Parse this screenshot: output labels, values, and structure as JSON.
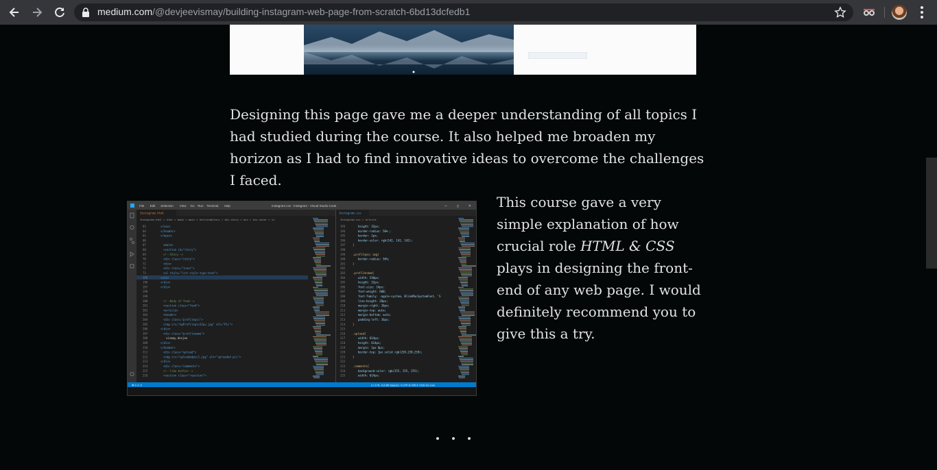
{
  "browser": {
    "url_host": "medium.com",
    "url_path": "/@devjeevismay/building-instagram-web-page-from-scratch-6bd13dcfedb1"
  },
  "article": {
    "paragraph1": "Designing this page gave me a deeper understanding of all topics I had studied during the course. It also helped me broaden my horizon as I had to find innovative ideas to overcome the challenges I faced.",
    "paragraph2_before": "This course gave a very simple explanation of how crucial role ",
    "paragraph2_em": "HTML & CSS",
    "paragraph2_after": " plays in designing the front-end of any web page. I would definitely recommend you to give this a try.",
    "separator": "· · ·"
  },
  "editor_screenshot": {
    "menu_items": [
      "File",
      "Edit",
      "Selection",
      "View",
      "Go",
      "Run",
      "Terminal",
      "Help"
    ],
    "window_title": "Instagram.css - Instagram - Visual Studio Code",
    "left_tab": "Instagram.html",
    "right_tab": "Instagram.css",
    "left_breadcrumb": "Instagram.html > html > body > main > Section#story > div.story > div > div.inner > ul",
    "right_breadcrumb": "Instagram.css > article",
    "left_lines": [
      {
        "n": "63",
        "t": "</nav>"
      },
      {
        "n": "64",
        "t": "</header>"
      },
      {
        "n": "65",
        "t": "</main>"
      },
      {
        "n": "66",
        "t": ""
      },
      {
        "n": "67",
        "t": "<main>"
      },
      {
        "n": "68",
        "t": "<section id=\"story\">"
      },
      {
        "n": "69",
        "t": "<!--Story-->"
      },
      {
        "n": "70",
        "t": "<div class=\"story\">"
      },
      {
        "n": "71",
        "t": "<div>"
      },
      {
        "n": "72",
        "t": "<div class=\"inner\">"
      },
      {
        "n": "73",
        "t": "<ul style=\"list-style-type:none\">"
      },
      {
        "n": "195",
        "t": "</ul>"
      },
      {
        "n": "196",
        "t": "</div>"
      },
      {
        "n": "197",
        "t": "</div>"
      },
      {
        "n": "198",
        "t": ""
      },
      {
        "n": "199",
        "t": ""
      },
      {
        "n": "200",
        "t": "<!--Body of feed-->"
      },
      {
        "n": "201",
        "t": "<section class=\"feed\">"
      },
      {
        "n": "202",
        "t": "<article>"
      },
      {
        "n": "203",
        "t": "<header>"
      },
      {
        "n": "204",
        "t": "<div class=\"profilepic\">"
      },
      {
        "n": "205",
        "t": "<img src=\"myProfilepic32px.jpg\" alt=\"Pic\">"
      },
      {
        "n": "206",
        "t": "</div>"
      },
      {
        "n": "207",
        "t": "<div class=\"profilename\">"
      },
      {
        "n": "208",
        "t": "vismay.devjee"
      },
      {
        "n": "209",
        "t": "</div>"
      },
      {
        "n": "210",
        "t": "</header>"
      },
      {
        "n": "211",
        "t": "<div class=\"upload\">"
      },
      {
        "n": "212",
        "t": "<img src=\"uploadedpic1.jpg\" alt=\"uploaded pic\">"
      },
      {
        "n": "213",
        "t": "</div>"
      },
      {
        "n": "214",
        "t": "<div class=\"comments\">"
      },
      {
        "n": "215",
        "t": "<!--like button-->"
      },
      {
        "n": "216",
        "t": "<section class=\"reaction\">"
      }
    ],
    "right_lines": [
      {
        "n": "193",
        "t": "height: 32px;"
      },
      {
        "n": "194",
        "t": "border-radius: 50% ;"
      },
      {
        "n": "195",
        "t": "border: 1px;"
      },
      {
        "n": "196",
        "t": "border-color: rgb(142, 142, 142);"
      },
      {
        "n": "197",
        "t": "}"
      },
      {
        "n": "198",
        "t": ""
      },
      {
        "n": "199",
        "t": ".profilepic img{"
      },
      {
        "n": "200",
        "t": "border-radius: 50%;"
      },
      {
        "n": "201",
        "t": "}"
      },
      {
        "n": "202",
        "t": ""
      },
      {
        "n": "203",
        "t": ".profilename{"
      },
      {
        "n": "204",
        "t": "width: 530px;"
      },
      {
        "n": "205",
        "t": "height: 32px;"
      },
      {
        "n": "206",
        "t": "font-size: 14px;"
      },
      {
        "n": "207",
        "t": "font-weight: 600;"
      },
      {
        "n": "208",
        "t": "font-family: -apple-system, BlinkMacSystemFont, 'S"
      },
      {
        "n": "209",
        "t": "line-height: 28px;"
      },
      {
        "n": "210",
        "t": "margin-right: 16px;"
      },
      {
        "n": "211",
        "t": "margin-top: auto;"
      },
      {
        "n": "212",
        "t": "margin-bottom: auto;"
      },
      {
        "n": "213",
        "t": "padding-left: 16px;"
      },
      {
        "n": "214",
        "t": "}"
      },
      {
        "n": "215",
        "t": ""
      },
      {
        "n": "216",
        "t": ".upload{"
      },
      {
        "n": "217",
        "t": "width: 614px;"
      },
      {
        "n": "218",
        "t": "height: 614px;"
      },
      {
        "n": "219",
        "t": "margin: 1px 0px;"
      },
      {
        "n": "220",
        "t": "border-top: 1px solid rgb(239,239,239);"
      },
      {
        "n": "221",
        "t": "}"
      },
      {
        "n": "222",
        "t": ""
      },
      {
        "n": "223",
        "t": ".comments{"
      },
      {
        "n": "224",
        "t": "background-color: rgb(255, 255, 255);"
      },
      {
        "n": "225",
        "t": "width: 614px;"
      }
    ],
    "status_left": "⊗ 0 ⚠ 0",
    "status_right": "Ln 179, Col 80   Spaces: 4   UTF-8   CRLF   CSS   Go Live",
    "colors": {
      "editor_bg": "#1e1e1e",
      "titlebar": "#3c3c3c",
      "statusbar": "#007acc",
      "tag": "#569cd6",
      "attr": "#9cdcfe",
      "string": "#ce9178",
      "comment": "#6a9955",
      "selector": "#d7ba7d",
      "text": "#d4d4d4"
    }
  }
}
